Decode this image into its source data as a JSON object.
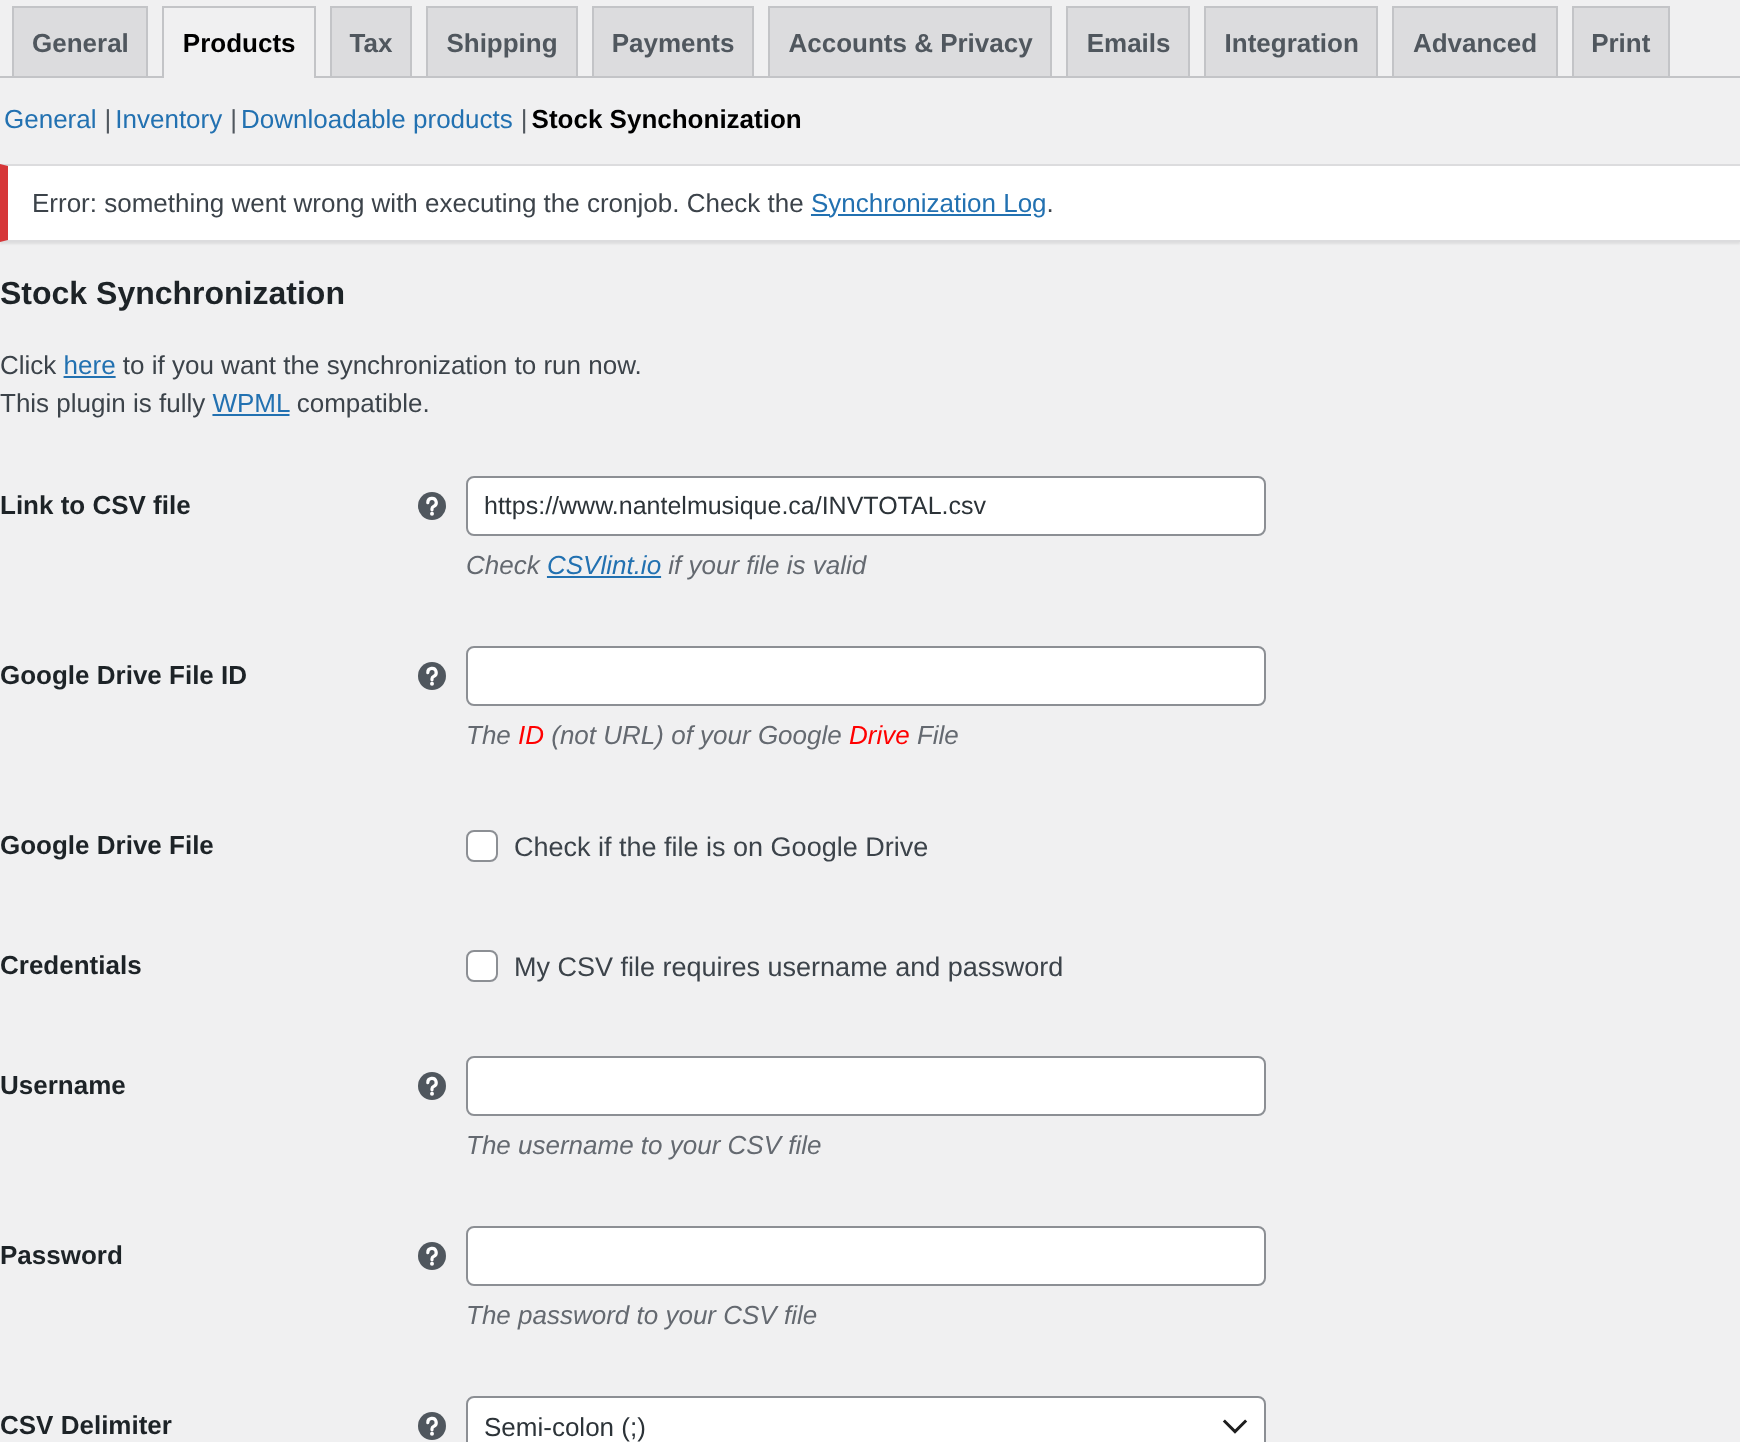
{
  "tabs": [
    {
      "label": "General",
      "selected": false
    },
    {
      "label": "Products",
      "selected": true
    },
    {
      "label": "Tax",
      "selected": false
    },
    {
      "label": "Shipping",
      "selected": false
    },
    {
      "label": "Payments",
      "selected": false
    },
    {
      "label": "Accounts & Privacy",
      "selected": false
    },
    {
      "label": "Emails",
      "selected": false
    },
    {
      "label": "Integration",
      "selected": false
    },
    {
      "label": "Advanced",
      "selected": false
    },
    {
      "label": "Print",
      "selected": false
    }
  ],
  "subnav": [
    {
      "label": "General",
      "selected": false
    },
    {
      "separator": "|",
      "label": "Inventory",
      "selected": false
    },
    {
      "separator": "|",
      "label": "Downloadable products",
      "selected": false
    },
    {
      "separator": "|",
      "label": "Stock Synchonization",
      "selected": true
    }
  ],
  "notice": {
    "kind": "error",
    "text": "Error: something went wrong with executing the cronjob. Check the ",
    "link": "Synchronization Log",
    "text_after": "."
  },
  "section": {
    "title": "Stock Synchronization",
    "intro": [
      [
        {
          "kind": "text",
          "text": "Click "
        },
        {
          "kind": "link",
          "text": "here"
        },
        {
          "kind": "text",
          "text": " to if you want the synchronization to run now."
        }
      ],
      [
        {
          "kind": "text",
          "text": "This plugin is fully "
        },
        {
          "kind": "link",
          "text": "WPML"
        },
        {
          "kind": "text",
          "text": " compatible."
        }
      ]
    ]
  },
  "fields": [
    {
      "kind": "text",
      "label": "Link to CSV file",
      "help": true,
      "value": "https://www.nantelmusique.ca/INVTOTAL.csv",
      "description": [
        {
          "kind": "text",
          "text": "Check "
        },
        {
          "kind": "link",
          "text": "CSVlint.io"
        },
        {
          "kind": "text",
          "text": " if your file is valid"
        }
      ]
    },
    {
      "kind": "text",
      "label": "Google Drive File ID",
      "help": true,
      "description": [
        {
          "kind": "text",
          "text": "The "
        },
        {
          "kind": "highlight",
          "text": "ID"
        },
        {
          "kind": "text",
          "text": " (not URL) of your Google "
        },
        {
          "kind": "highlight",
          "text": "Drive"
        },
        {
          "kind": "text",
          "text": " File"
        }
      ]
    },
    {
      "kind": "checkbox",
      "label": "Google Drive File",
      "help": false,
      "checked": false,
      "text": "Check if the file is on Google Drive"
    },
    {
      "kind": "checkbox",
      "label": "Credentials",
      "help": false,
      "checked": false,
      "text": "My CSV file requires username and password"
    },
    {
      "kind": "text",
      "label": "Username",
      "help": true,
      "description": [
        {
          "kind": "text",
          "text": "The username to your CSV file"
        }
      ]
    },
    {
      "kind": "text",
      "label": "Password",
      "help": true,
      "description": [
        {
          "kind": "text",
          "text": "The password to your CSV file"
        }
      ]
    },
    {
      "kind": "select",
      "label": "CSV Delimiter",
      "help": true,
      "value": "Semi-colon (;)"
    }
  ]
}
